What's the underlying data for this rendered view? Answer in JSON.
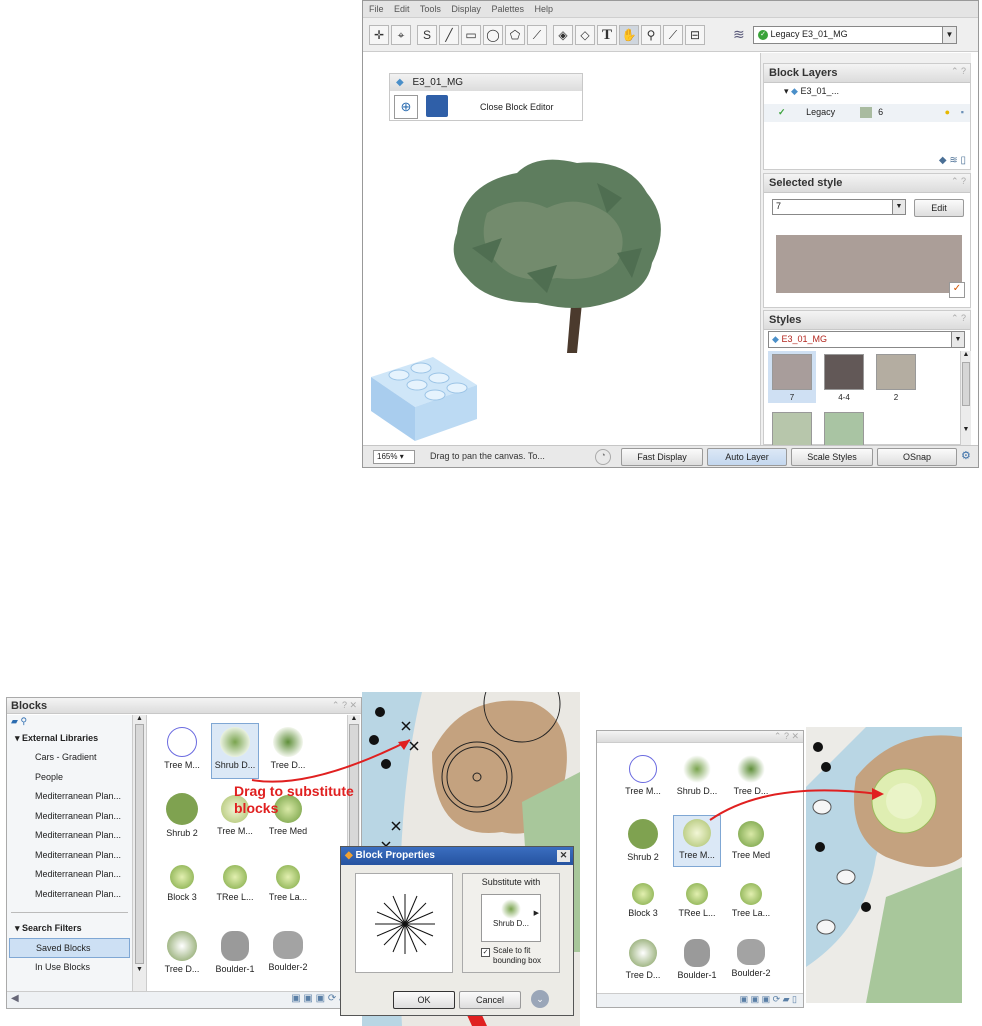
{
  "top": {
    "menu": [
      "File",
      "Edit",
      "Tools",
      "Display",
      "Palettes",
      "Help"
    ],
    "layer_select": "Legacy  E3_01_MG",
    "block_editor": {
      "title": "E3_01_MG",
      "close_label": "Close Block Editor"
    },
    "block_layers": {
      "title": "Block Layers",
      "parent": "E3_01_...",
      "layer_name": "Legacy",
      "layer_num": "6"
    },
    "selected_style": {
      "title": "Selected style",
      "value": "7",
      "edit_label": "Edit",
      "swatch_color": "#ab9e98"
    },
    "styles": {
      "title": "Styles",
      "dropdown": "E3_01_MG",
      "items": [
        {
          "label": "7",
          "color": "#a89d9b"
        },
        {
          "label": "4-4",
          "color": "#625857"
        },
        {
          "label": "2",
          "color": "#b4ada1"
        },
        {
          "label": "",
          "color": "#b7c6ab"
        },
        {
          "label": "",
          "color": "#a9c4a3"
        }
      ]
    },
    "status": {
      "zoom": "165%",
      "hint": "Drag to pan the canvas. To...",
      "fast_display": "Fast Display",
      "auto_layer": "Auto Layer",
      "scale_styles": "Scale Styles",
      "osnap": "OSnap"
    }
  },
  "blocks": {
    "title": "Blocks",
    "external_libraries": "External Libraries",
    "libraries": [
      "Cars - Gradient",
      "People",
      "Mediterranean  Plan...",
      "Mediterranean  Plan...",
      "Mediterranean  Plan...",
      "Mediterranean  Plan...",
      "Mediterranean  Plan...",
      "Mediterranean  Plan..."
    ],
    "search_filters": "Search Filters",
    "filters": [
      "Saved Blocks",
      "In Use Blocks"
    ],
    "items": [
      "Tree M...",
      "Shrub D...",
      "Tree D...",
      "Shrub 2",
      "Tree M...",
      "Tree Med",
      "Block 3",
      "TRee L...",
      "Tree La...",
      "Tree D...",
      "Boulder-1",
      "Boulder-2"
    ]
  },
  "annotation": "Drag to substitute blocks",
  "dialog": {
    "title": "Block Properties",
    "substitute_with": "Substitute with",
    "substitute_item": "Shrub D...",
    "scale_label": "Scale to fit bounding box",
    "ok": "OK",
    "cancel": "Cancel"
  },
  "right_blocks": {
    "items": [
      "Tree M...",
      "Shrub D...",
      "Tree D...",
      "Shrub 2",
      "Tree M...",
      "Tree Med",
      "Block 3",
      "TRee L...",
      "Tree La...",
      "Tree D...",
      "Boulder-1",
      "Boulder-2"
    ]
  }
}
